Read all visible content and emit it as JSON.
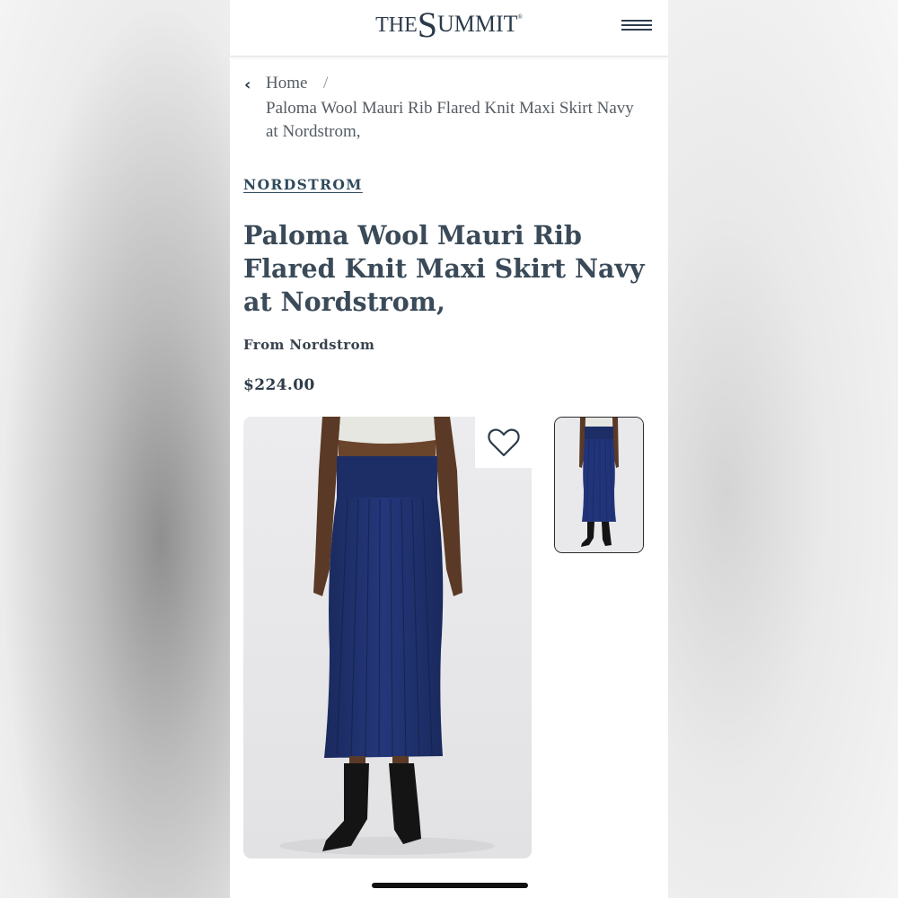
{
  "header": {
    "logo_the": "THE",
    "logo_s": "S",
    "logo_rest": "UMMIT",
    "logo_reg": "®"
  },
  "breadcrumb": {
    "home_label": "Home",
    "separator": "/",
    "current": "Paloma Wool Mauri Rib Flared Knit Maxi Skirt Navy at Nordstrom,"
  },
  "product": {
    "retailer": "NORDSTROM",
    "title": "Paloma Wool Mauri Rib Flared Knit Maxi Skirt Navy at Nordstrom,",
    "from_text": "From Nordstrom",
    "price": "$224.00"
  },
  "icons": {
    "back": "chevron-left-icon",
    "menu": "hamburger-menu-icon",
    "favorite": "heart-icon"
  },
  "colors": {
    "brand_text": "#2b3a4a",
    "skirt_navy": "#1f2f66",
    "background": "#ffffff"
  }
}
